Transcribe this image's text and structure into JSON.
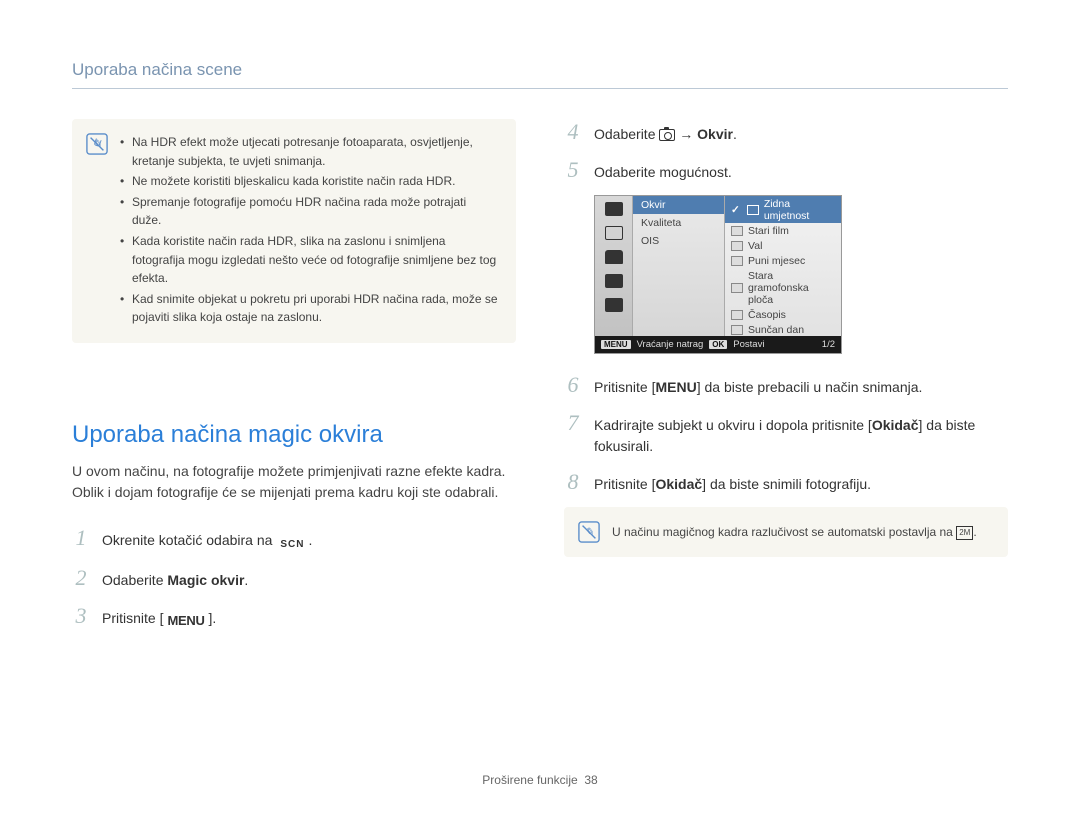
{
  "header": {
    "title": "Uporaba načina scene"
  },
  "note_box": {
    "items": [
      "Na HDR efekt može utjecati potresanje fotoaparata, osvjetljenje, kretanje subjekta, te uvjeti snimanja.",
      "Ne možete koristiti bljeskalicu kada koristite način rada HDR.",
      "Spremanje fotografije pomoću HDR načina rada može potrajati duže.",
      "Kada koristite način rada HDR, slika na zaslonu i snimljena fotografija mogu izgledati nešto veće od fotografije snimljene bez tog efekta.",
      "Kad snimite objekat u pokretu pri uporabi HDR načina rada, može se pojaviti slika koja ostaje na zaslonu."
    ]
  },
  "section": {
    "title": "Uporaba načina magic okvira",
    "intro": "U ovom načinu, na fotografije možete primjenjivati razne efekte kadra. Oblik i dojam fotografije će se mijenjati prema kadru koji ste odabrali."
  },
  "steps_left": {
    "1": {
      "pre": "Okrenite kotačić odabira na ",
      "label": "SCN",
      "post": "."
    },
    "2": {
      "pre": "Odaberite ",
      "bold": "Magic okvir",
      "post": "."
    },
    "3": {
      "pre": "Pritisnite [",
      "label": "MENU",
      "post": "]."
    }
  },
  "steps_right": {
    "4": {
      "pre": "Odaberite ",
      "arrow": " → ",
      "bold": "Okvir",
      "post": "."
    },
    "5": {
      "text": "Odaberite mogućnost."
    },
    "6": {
      "pre": "Pritisnite [",
      "label": "MENU",
      "post": "] da biste prebacili u način snimanja."
    },
    "7": {
      "pre": "Kadrirajte subjekt u okviru i dopola pritisnite [",
      "bold": "Okidač",
      "post": "] da biste fokusirali."
    },
    "8": {
      "pre": "Pritisnite [",
      "bold": "Okidač",
      "post": "] da biste snimili fotografiju."
    }
  },
  "menu": {
    "mid": {
      "row1": "Okvir",
      "row2": "Kvaliteta",
      "row3": "OIS"
    },
    "right": {
      "row1": "Zidna umjetnost",
      "row2": "Stari film",
      "row3": "Val",
      "row4": "Puni mjesec",
      "row5": "Stara gramofonska ploča",
      "row6": "Časopis",
      "row7": "Sunčan dan"
    },
    "foot": {
      "menu": "MENU",
      "back": "Vraćanje natrag",
      "ok": "OK",
      "set": "Postavi",
      "page": "1/2"
    }
  },
  "note2": {
    "text_pre": "U načinu magičnog kadra razlučivost se automatski postavlja na ",
    "res": "2M",
    "text_post": "."
  },
  "footer": {
    "label": "Proširene funkcije",
    "page": "38"
  },
  "chart_data": null
}
